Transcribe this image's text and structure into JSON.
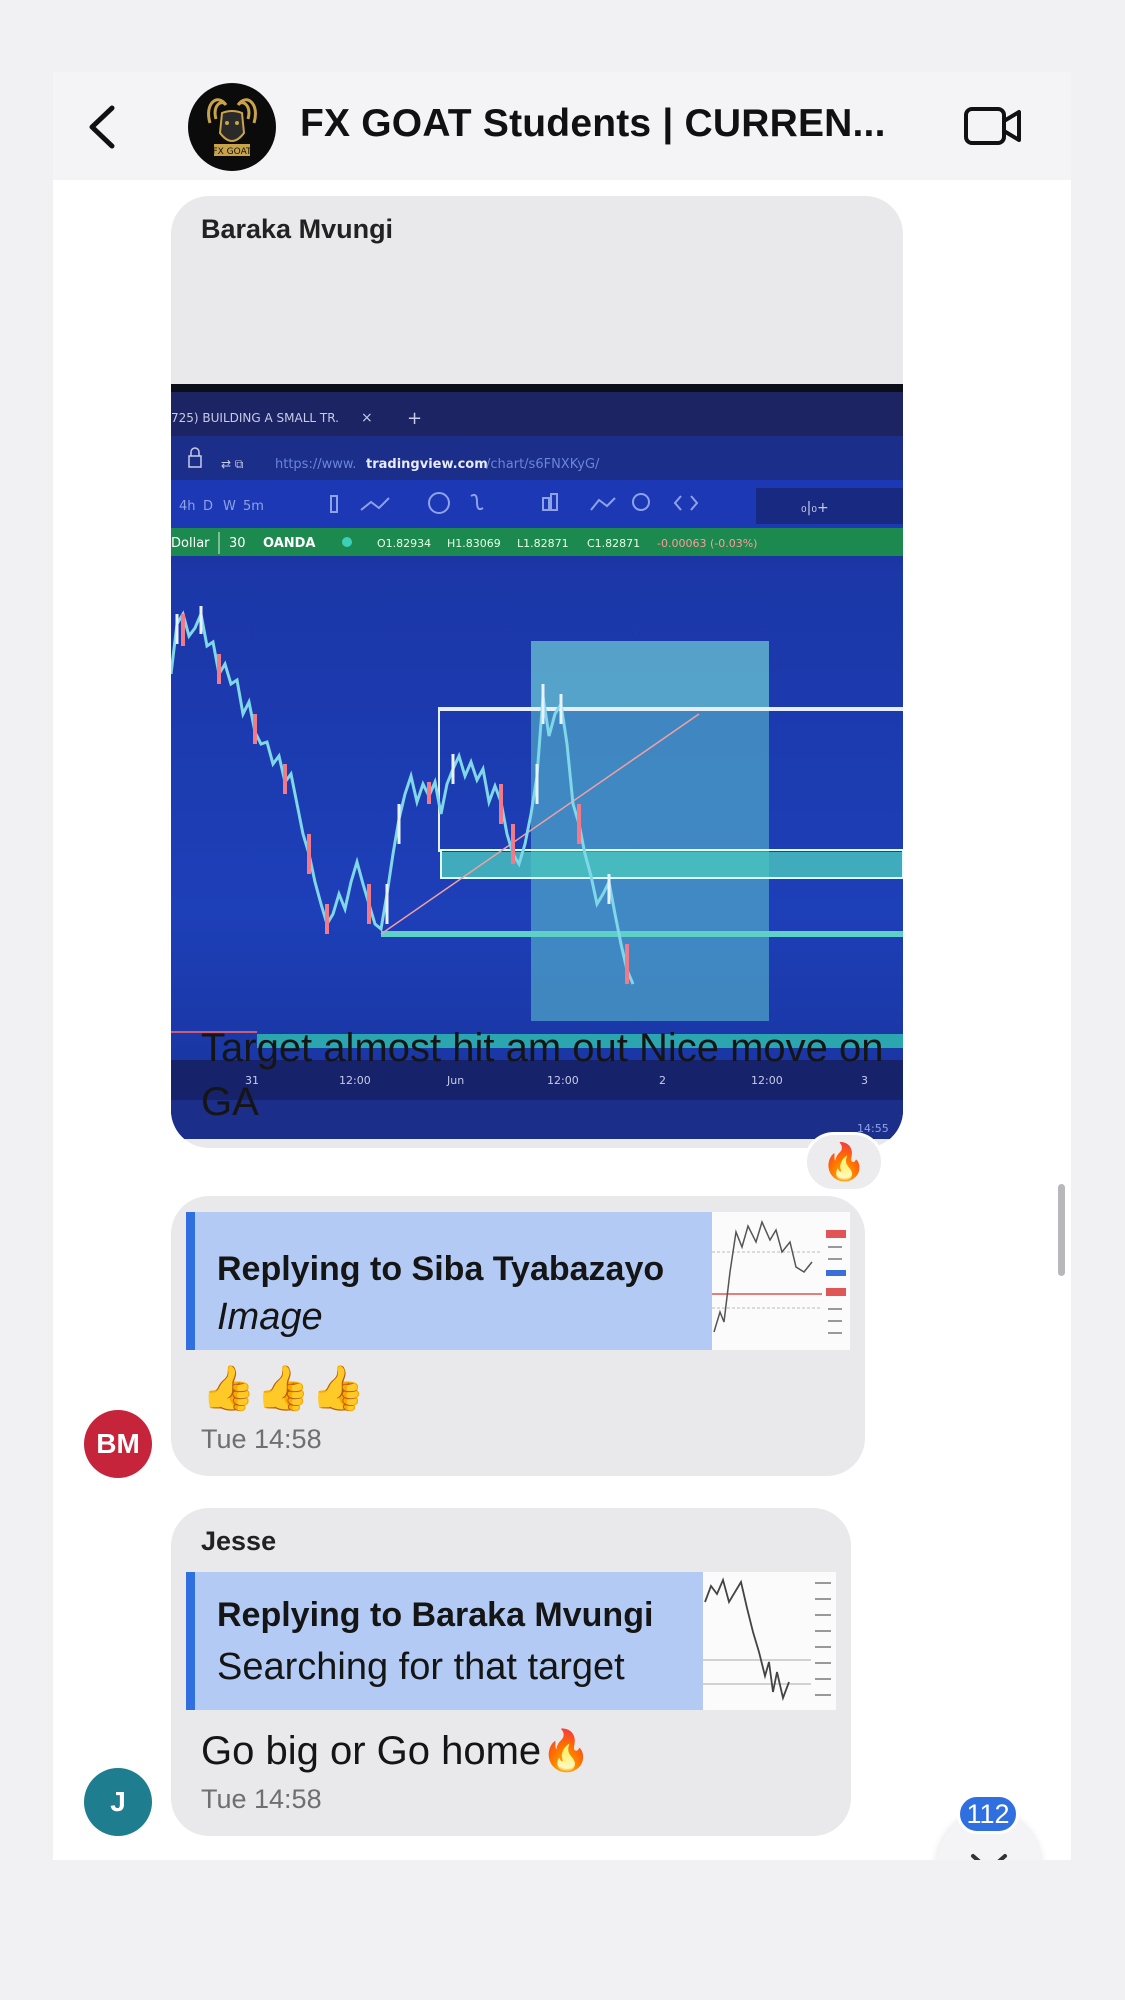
{
  "header": {
    "title": "FX GOAT Students | CURREN...",
    "avatar_text": "FX GOAT",
    "back_icon": "chevron-left-icon",
    "video_icon": "video-camera-icon"
  },
  "messages": [
    {
      "sender": "Baraka Mvungi",
      "image": {
        "tab_title": "725) BUILDING A SMALL TR.",
        "tab_close": "×",
        "tab_new": "+",
        "url_prefix": "https://www.",
        "url_domain": "tradingview.com",
        "url_path": "/chart/s6FNXKyG/",
        "intervals": [
          "4h",
          "D",
          "W",
          "5m"
        ],
        "symbol_name": "Dollar",
        "symbol_tf": "30",
        "broker": "OANDA",
        "ohlc_o": "O1.82934",
        "ohlc_h": "H1.83069",
        "ohlc_l": "L1.82871",
        "ohlc_c": "C1.82871",
        "ohlc_change": "-0.00063 (-0.03%)",
        "time_labels": [
          "31",
          "12:00",
          "Jun",
          "12:00",
          "2",
          "12:00",
          "3"
        ],
        "clock": "14:55"
      },
      "text": "Target almost hit am out Nice move on GA",
      "reaction": "🔥"
    },
    {
      "reply_to": "Replying to Siba Tyabazayo",
      "reply_preview": "Image",
      "text": "👍👍👍",
      "time": "Tue 14:58",
      "avatar_initials": "BM"
    },
    {
      "sender": "Jesse",
      "reply_to": "Replying to Baraka Mvungi",
      "reply_preview": "Searching for that target",
      "text": "Go big or Go home🔥",
      "time": "Tue 14:58",
      "avatar_initials": "J"
    }
  ],
  "unread_count": "112",
  "colors": {
    "accent": "#2f6fe0",
    "reply_bg": "#b3cbf4",
    "bubble_bg": "#e9e9eb",
    "avatar_bm": "#c6243a",
    "avatar_j": "#1e7d8f"
  }
}
